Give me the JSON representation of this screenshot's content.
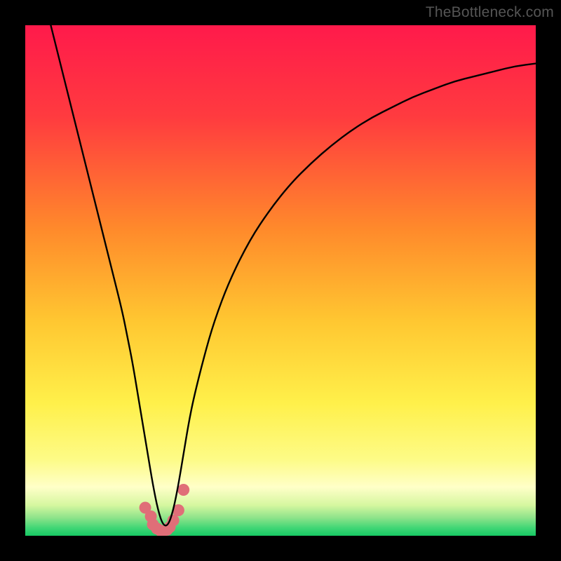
{
  "watermark": "TheBottleneck.com",
  "chart_data": {
    "type": "line",
    "title": "",
    "xlabel": "",
    "ylabel": "",
    "xlim": [
      0,
      100
    ],
    "ylim": [
      0,
      100
    ],
    "x_at_minimum": 27,
    "gradient_stops": [
      {
        "offset": 0.0,
        "color": "#ff1a4b"
      },
      {
        "offset": 0.18,
        "color": "#ff3b3f"
      },
      {
        "offset": 0.4,
        "color": "#ff8a2b"
      },
      {
        "offset": 0.58,
        "color": "#ffc731"
      },
      {
        "offset": 0.74,
        "color": "#fff04a"
      },
      {
        "offset": 0.85,
        "color": "#fdfb86"
      },
      {
        "offset": 0.905,
        "color": "#ffffc8"
      },
      {
        "offset": 0.94,
        "color": "#d6f7a0"
      },
      {
        "offset": 0.965,
        "color": "#8de38a"
      },
      {
        "offset": 0.985,
        "color": "#3fd675"
      },
      {
        "offset": 1.0,
        "color": "#17c964"
      }
    ],
    "series": [
      {
        "name": "bottleneck-curve",
        "x": [
          5,
          7,
          9,
          11,
          13,
          15,
          17,
          19,
          20,
          21,
          22,
          23,
          24,
          25,
          26,
          27,
          28,
          29,
          30,
          31,
          32,
          33,
          35,
          37,
          40,
          44,
          48,
          52,
          56,
          60,
          64,
          68,
          72,
          76,
          80,
          84,
          88,
          92,
          96,
          100
        ],
        "y": [
          100,
          92,
          84,
          76,
          68,
          60,
          52,
          44,
          39,
          34,
          28,
          22,
          16,
          10,
          5,
          2,
          2,
          5,
          10,
          16,
          22,
          27,
          35,
          42,
          50,
          58,
          64,
          69,
          73,
          76.5,
          79.5,
          82,
          84,
          86,
          87.5,
          89,
          90,
          91,
          92,
          92.5
        ]
      }
    ],
    "markers": {
      "name": "bottom-cluster",
      "x": [
        23.5,
        24.6,
        25.0,
        25.8,
        26.5,
        27.0,
        27.8,
        28.3,
        29.0,
        30.0,
        31.0
      ],
      "y": [
        5.5,
        3.8,
        2.2,
        1.4,
        1.0,
        0.9,
        1.2,
        1.7,
        3.0,
        5.0,
        9.0
      ],
      "color": "#e06e78",
      "radius": 8.5
    }
  }
}
